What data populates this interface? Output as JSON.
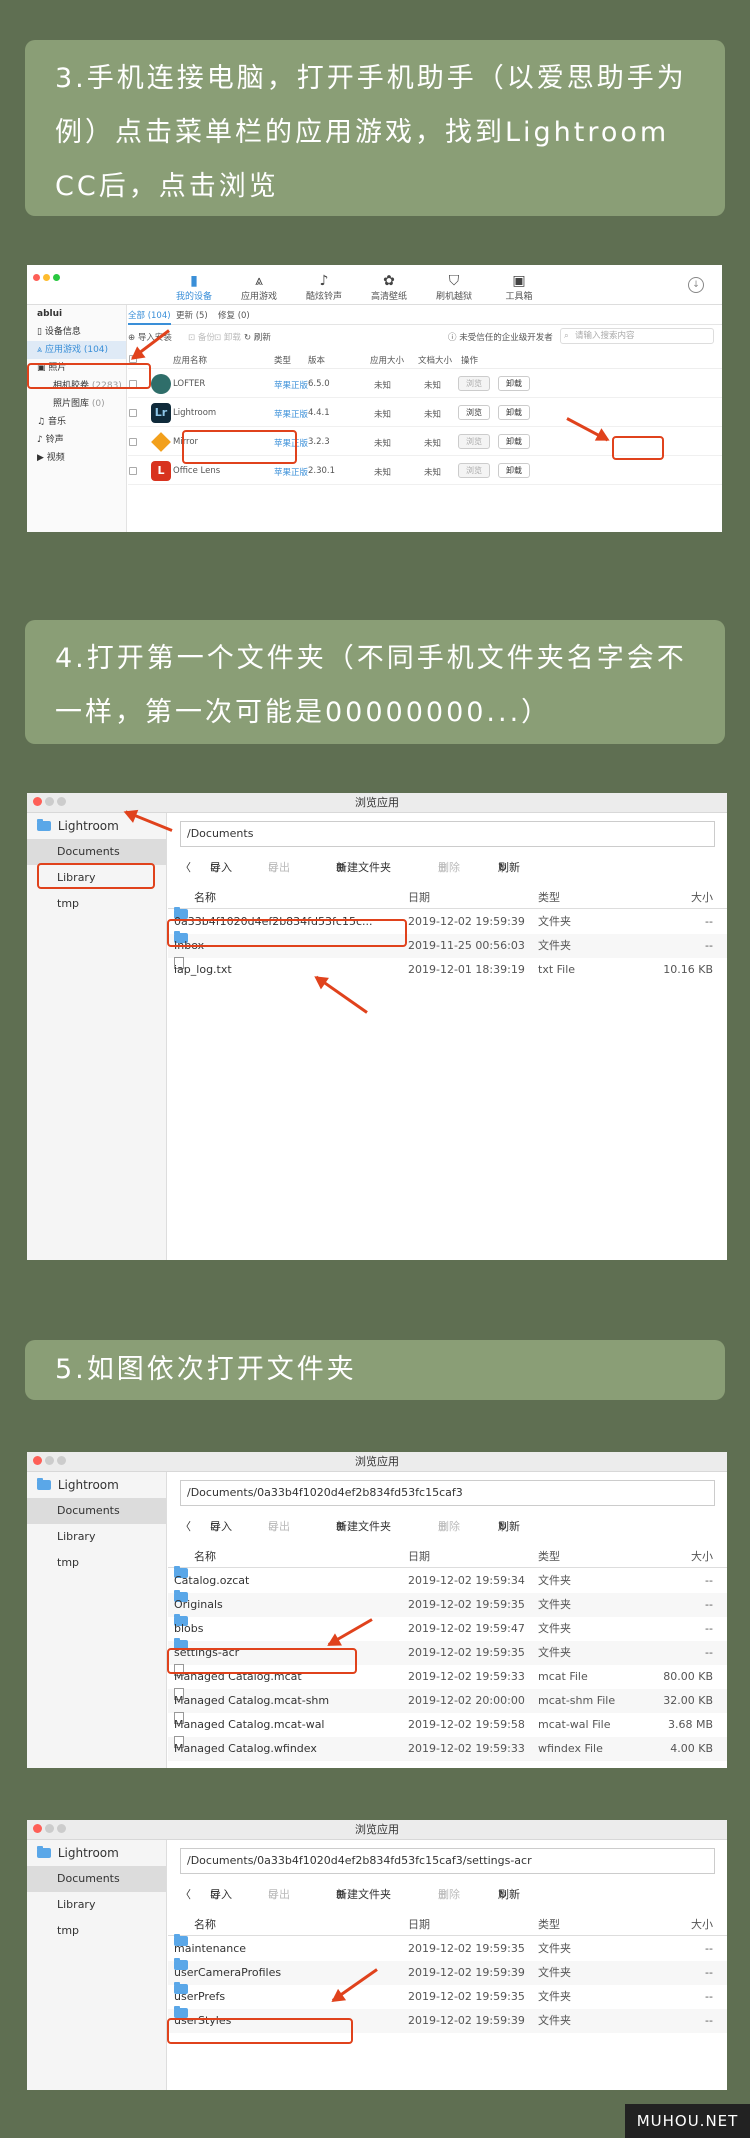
{
  "steps": [
    {
      "text": "3.手机连接电脑，打开手机助手（以爱思助手为例）点击菜单栏的应用游戏，找到Lightroom CC后，点击浏览"
    },
    {
      "text": "4.打开第一个文件夹（不同手机文件夹名字会不一样，第一次可能是00000000...）"
    },
    {
      "text": "5.如图依次打开文件夹"
    }
  ],
  "assistant": {
    "nav": [
      {
        "label": "我的设备",
        "icon": "▮"
      },
      {
        "label": "应用游戏",
        "icon": "⩓"
      },
      {
        "label": "酷炫铃声",
        "icon": "♪"
      },
      {
        "label": "高清壁纸",
        "icon": "✿"
      },
      {
        "label": "刷机越狱",
        "icon": "⛉"
      },
      {
        "label": "工具箱",
        "icon": "▣"
      }
    ],
    "sidebar": {
      "device": "ablui",
      "items": [
        {
          "label": "设备信息"
        },
        {
          "label": "应用游戏",
          "count": "(104)"
        },
        {
          "label": "照片"
        },
        {
          "label": "相机胶卷",
          "count": "(2283)"
        },
        {
          "label": "照片图库",
          "count": "(0)"
        },
        {
          "label": "音乐"
        },
        {
          "label": "铃声"
        },
        {
          "label": "视频"
        }
      ]
    },
    "tabs": [
      {
        "label": "全部 (104)"
      },
      {
        "label": "更新 (5)"
      },
      {
        "label": "修复 (0)"
      }
    ],
    "actions": {
      "import": "导入安装",
      "backup": "备份",
      "uninstall": "卸载",
      "refresh": "刷新"
    },
    "trusted": "未受信任的企业级开发者",
    "search_placeholder": "请输入搜索内容",
    "columns": {
      "name": "应用名称",
      "type": "类型",
      "version": "版本",
      "app_size": "应用大小",
      "doc_size": "文档大小",
      "op": "操作"
    },
    "rows": [
      {
        "name": "LOFTER",
        "type": "苹果正版",
        "version": "6.5.0",
        "app_size": "未知",
        "doc_size": "未知",
        "browse": "浏览",
        "uninstall": "卸载",
        "color": "#2f6e6a"
      },
      {
        "name": "Lightroom",
        "type": "苹果正版",
        "version": "4.4.1",
        "app_size": "未知",
        "doc_size": "未知",
        "browse": "浏览",
        "uninstall": "卸载",
        "color": "#0f2a3a"
      },
      {
        "name": "Mirror",
        "type": "苹果正版",
        "version": "3.2.3",
        "app_size": "未知",
        "doc_size": "未知",
        "browse": "浏览",
        "uninstall": "卸载",
        "color": "#f2a01c"
      },
      {
        "name": "Office Lens",
        "type": "苹果正版",
        "version": "2.30.1",
        "app_size": "未知",
        "doc_size": "未知",
        "browse": "浏览",
        "uninstall": "卸载",
        "color": "#d8331f"
      }
    ],
    "lr_icon_text": "Lr",
    "lens_icon_text": "L"
  },
  "browsers": [
    {
      "title": "浏览应用",
      "sidebar": {
        "root": "Lightroom",
        "items": [
          "Documents",
          "Library",
          "tmp"
        ]
      },
      "path": "/Documents",
      "toolbar": {
        "back": "〈",
        "import": "导入",
        "export": "导出",
        "newfolder": "新建文件夹",
        "delete": "删除",
        "refresh": "刷新"
      },
      "columns": {
        "name": "名称",
        "date": "日期",
        "type": "类型",
        "size": "大小"
      },
      "rows": [
        {
          "name": "0a33b4f1020d4ef2b834fd53fc15c...",
          "date": "2019-12-02 19:59:39",
          "type": "文件夹",
          "size": "--",
          "kind": "folder"
        },
        {
          "name": "Inbox",
          "date": "2019-11-25 00:56:03",
          "type": "文件夹",
          "size": "--",
          "kind": "folder"
        },
        {
          "name": "iap_log.txt",
          "date": "2019-12-01 18:39:19",
          "type": "txt File",
          "size": "10.16 KB",
          "kind": "file"
        }
      ]
    },
    {
      "title": "浏览应用",
      "sidebar": {
        "root": "Lightroom",
        "items": [
          "Documents",
          "Library",
          "tmp"
        ]
      },
      "path": "/Documents/0a33b4f1020d4ef2b834fd53fc15caf3",
      "toolbar": {
        "back": "〈",
        "import": "导入",
        "export": "导出",
        "newfolder": "新建文件夹",
        "delete": "删除",
        "refresh": "刷新"
      },
      "columns": {
        "name": "名称",
        "date": "日期",
        "type": "类型",
        "size": "大小"
      },
      "rows": [
        {
          "name": "Catalog.ozcat",
          "date": "2019-12-02 19:59:34",
          "type": "文件夹",
          "size": "--",
          "kind": "folder"
        },
        {
          "name": "Originals",
          "date": "2019-12-02 19:59:35",
          "type": "文件夹",
          "size": "--",
          "kind": "folder"
        },
        {
          "name": "blobs",
          "date": "2019-12-02 19:59:47",
          "type": "文件夹",
          "size": "--",
          "kind": "folder"
        },
        {
          "name": "settings-acr",
          "date": "2019-12-02 19:59:35",
          "type": "文件夹",
          "size": "--",
          "kind": "folder"
        },
        {
          "name": "Managed Catalog.mcat",
          "date": "2019-12-02 19:59:33",
          "type": "mcat File",
          "size": "80.00 KB",
          "kind": "file"
        },
        {
          "name": "Managed Catalog.mcat-shm",
          "date": "2019-12-02 20:00:00",
          "type": "mcat-shm File",
          "size": "32.00 KB",
          "kind": "file"
        },
        {
          "name": "Managed Catalog.mcat-wal",
          "date": "2019-12-02 19:59:58",
          "type": "mcat-wal File",
          "size": "3.68 MB",
          "kind": "file"
        },
        {
          "name": "Managed Catalog.wfindex",
          "date": "2019-12-02 19:59:33",
          "type": "wfindex File",
          "size": "4.00 KB",
          "kind": "file"
        }
      ]
    },
    {
      "title": "浏览应用",
      "sidebar": {
        "root": "Lightroom",
        "items": [
          "Documents",
          "Library",
          "tmp"
        ]
      },
      "path": "/Documents/0a33b4f1020d4ef2b834fd53fc15caf3/settings-acr",
      "toolbar": {
        "back": "〈",
        "import": "导入",
        "export": "导出",
        "newfolder": "新建文件夹",
        "delete": "删除",
        "refresh": "刷新"
      },
      "columns": {
        "name": "名称",
        "date": "日期",
        "type": "类型",
        "size": "大小"
      },
      "rows": [
        {
          "name": "maintenance",
          "date": "2019-12-02 19:59:35",
          "type": "文件夹",
          "size": "--",
          "kind": "folder"
        },
        {
          "name": "userCameraProfiles",
          "date": "2019-12-02 19:59:39",
          "type": "文件夹",
          "size": "--",
          "kind": "folder"
        },
        {
          "name": "userPrefs",
          "date": "2019-12-02 19:59:35",
          "type": "文件夹",
          "size": "--",
          "kind": "folder"
        },
        {
          "name": "userStyles",
          "date": "2019-12-02 19:59:39",
          "type": "文件夹",
          "size": "--",
          "kind": "folder"
        }
      ]
    }
  ],
  "watermark": "MUHOU.NET",
  "colors": {
    "background": "#5f6f52",
    "step_box": "#8a9e76",
    "highlight": "#e0421c",
    "folder": "#5aa7e8",
    "link_green": "#3a8fd8"
  }
}
